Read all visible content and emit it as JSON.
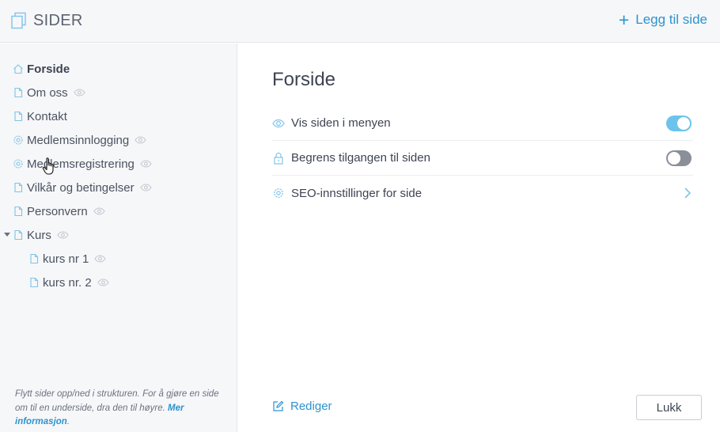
{
  "header": {
    "title": "SIDER",
    "add_icon": "plus-icon",
    "add_label": "Legg til side"
  },
  "sidebar": {
    "items": [
      {
        "label": "Forside",
        "icon": "home-icon",
        "active": true,
        "eye": false
      },
      {
        "label": "Om oss",
        "icon": "page-icon",
        "eye": true
      },
      {
        "label": "Kontakt",
        "icon": "page-icon",
        "eye": false
      },
      {
        "label": "Medlemsinnlogging",
        "icon": "gear-icon",
        "eye": true
      },
      {
        "label": "Medlemsregistrering",
        "icon": "gear-icon",
        "eye": true
      },
      {
        "label": "Vilkår og betingelser",
        "icon": "page-icon",
        "eye": true
      },
      {
        "label": "Personvern",
        "icon": "page-icon",
        "eye": true
      },
      {
        "label": "Kurs",
        "icon": "page-icon",
        "eye": true,
        "expanded": true
      },
      {
        "label": "kurs nr 1",
        "icon": "page-icon",
        "eye": true,
        "child": true
      },
      {
        "label": "kurs nr. 2",
        "icon": "page-icon",
        "eye": true,
        "child": true
      }
    ],
    "hint_text": "Flytt sider opp/ned i strukturen. For å gjøre en side om til en underside, dra den til høyre. ",
    "hint_link": "Mer informasjon",
    "hint_end": "."
  },
  "main": {
    "page_title": "Forside",
    "settings": [
      {
        "label": "Vis siden i menyen",
        "icon": "eye-icon",
        "control": "toggle",
        "value": true
      },
      {
        "label": "Begrens tilgangen til siden",
        "icon": "lock-icon",
        "control": "toggle",
        "value": false
      },
      {
        "label": "SEO-innstillinger for side",
        "icon": "gear-icon",
        "control": "chevron"
      }
    ],
    "edit_label": "Rediger",
    "close_label": "Lukk"
  },
  "colors": {
    "accent": "#2c93cf",
    "toggle_on": "#6cc3ec",
    "toggle_off": "#8b8f9a",
    "sidebar_bg": "#f6f7f9"
  }
}
